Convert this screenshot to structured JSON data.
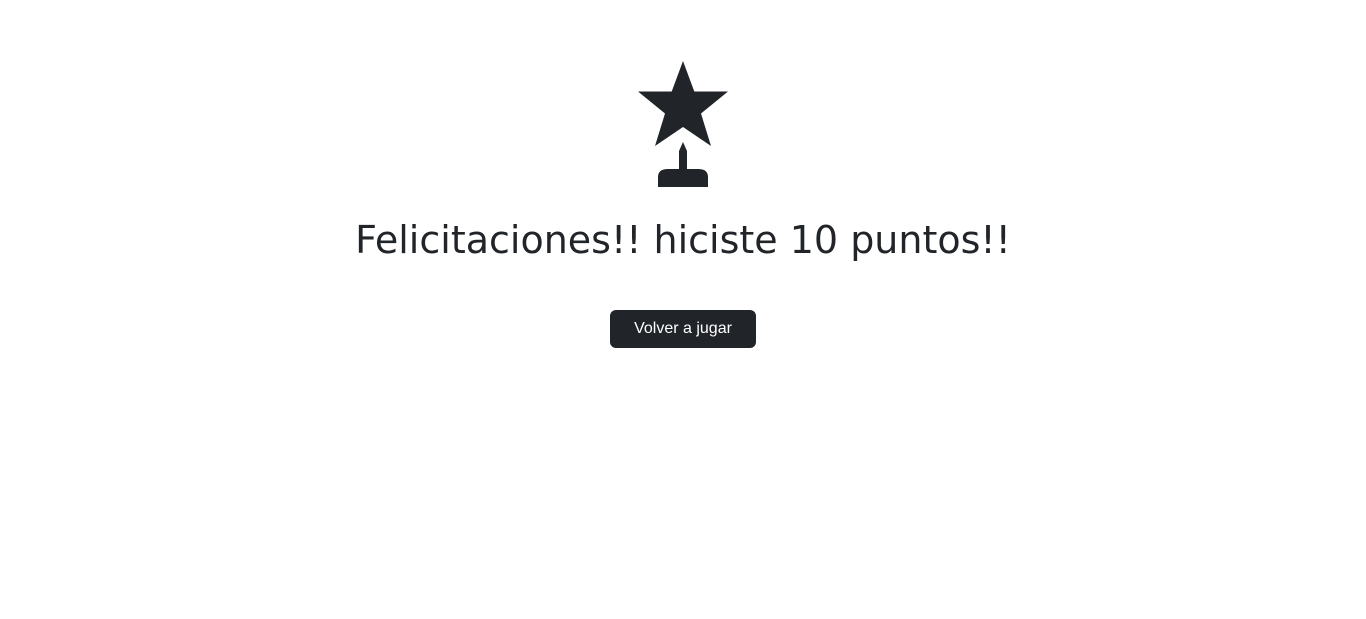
{
  "result": {
    "message": "Felicitaciones!! hiciste 10 puntos!!",
    "icon": "trophy-star-icon"
  },
  "actions": {
    "play_again_label": "Volver a jugar"
  },
  "colors": {
    "background": "#ffffff",
    "text": "#212529",
    "button_bg": "#212529",
    "button_text": "#ffffff"
  }
}
